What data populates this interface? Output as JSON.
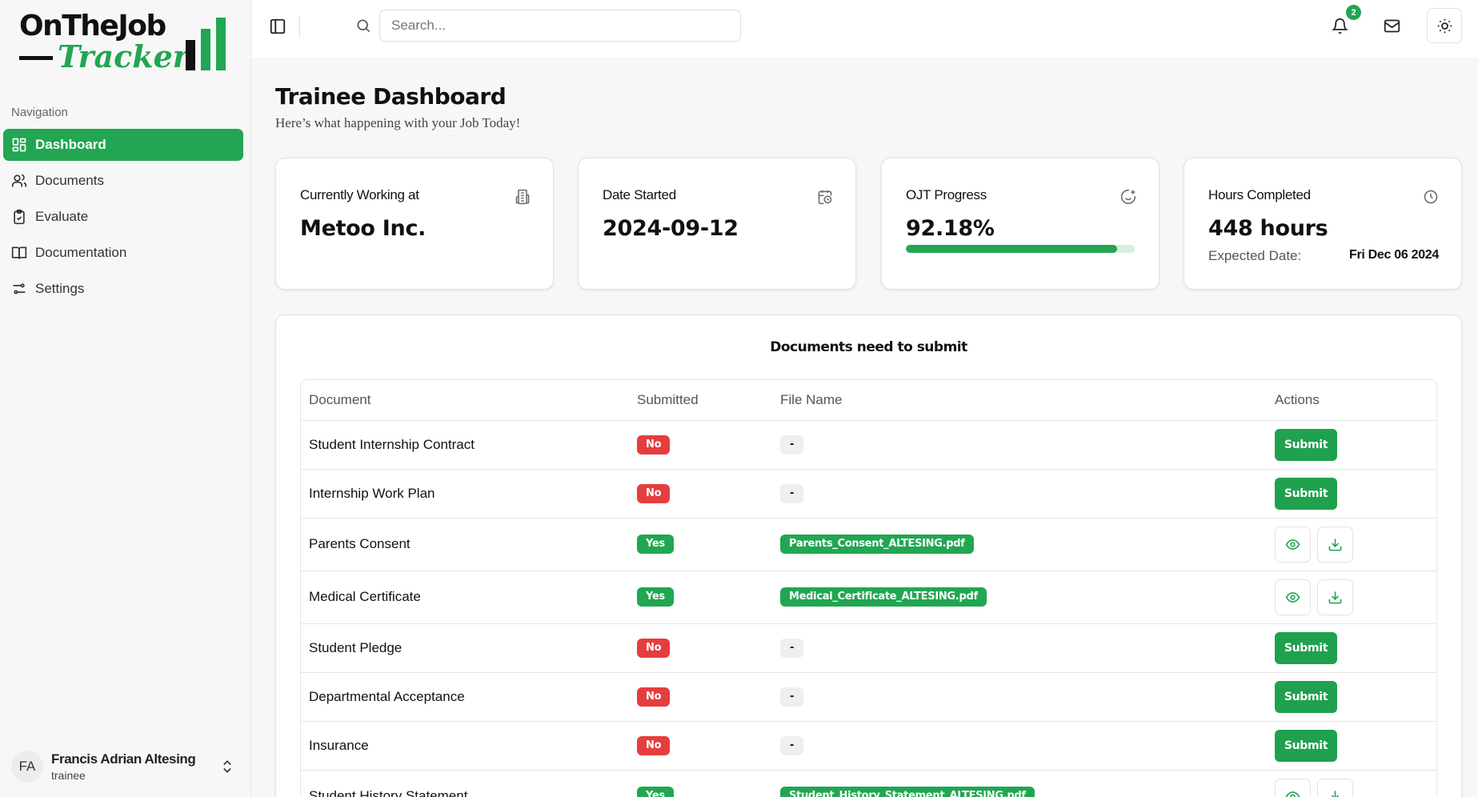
{
  "logo": {
    "line1": "OnTheJob",
    "line2": "Tracker."
  },
  "colors": {
    "accent": "#22a652",
    "danger": "#e53e3e"
  },
  "nav": {
    "title": "Navigation",
    "items": [
      {
        "label": "Dashboard",
        "icon": "dashboard-icon",
        "active": true
      },
      {
        "label": "Documents",
        "icon": "users-icon"
      },
      {
        "label": "Evaluate",
        "icon": "clipboard-icon"
      },
      {
        "label": "Documentation",
        "icon": "book-icon"
      },
      {
        "label": "Settings",
        "icon": "sliders-icon"
      }
    ]
  },
  "user": {
    "initials": "FA",
    "name": "Francis Adrian Altesing",
    "role": "trainee"
  },
  "header": {
    "search_placeholder": "Search...",
    "notification_count": "2"
  },
  "page": {
    "title": "Trainee Dashboard",
    "subtitle": "Here’s what happening with your Job Today!"
  },
  "cards": {
    "company": {
      "label": "Currently Working at",
      "value": "Metoo Inc."
    },
    "date": {
      "label": "Date Started",
      "value": "2024-09-12"
    },
    "progress": {
      "label": "OJT Progress",
      "value": "92.18%",
      "fraction": 0.9218
    },
    "hours": {
      "label": "Hours Completed",
      "value": "448 hours",
      "expected_label": "Expected Date:",
      "expected_value": "Fri Dec 06 2024"
    }
  },
  "documents": {
    "title": "Documents need to submit",
    "columns": [
      "Document",
      "Submitted",
      "File Name",
      "Actions"
    ],
    "rows": [
      {
        "document": "Student Internship Contract",
        "submitted": "No",
        "file": "-",
        "action": "Submit"
      },
      {
        "document": "Internship Work Plan",
        "submitted": "No",
        "file": "-",
        "action": "Submit"
      },
      {
        "document": "Parents Consent",
        "submitted": "Yes",
        "file": "Parents_Consent_ALTESING.pdf",
        "action": ""
      },
      {
        "document": "Medical Certificate",
        "submitted": "Yes",
        "file": "Medical_Certificate_ALTESING.pdf",
        "action": ""
      },
      {
        "document": "Student Pledge",
        "submitted": "No",
        "file": "-",
        "action": "Submit"
      },
      {
        "document": "Departmental Acceptance",
        "submitted": "No",
        "file": "-",
        "action": "Submit"
      },
      {
        "document": "Insurance",
        "submitted": "No",
        "file": "-",
        "action": "Submit"
      },
      {
        "document": "Student History Statement",
        "submitted": "Yes",
        "file": "Student_History_Statement_ALTESING.pdf",
        "action": ""
      }
    ]
  }
}
